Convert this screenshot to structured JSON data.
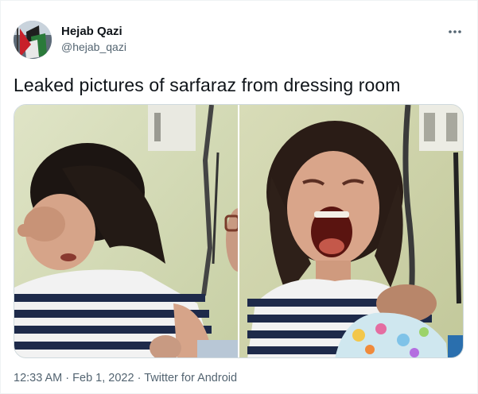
{
  "author": {
    "display_name": "Hejab Qazi",
    "handle": "@hejab_qazi"
  },
  "menu": {
    "more_icon": "more-horizontal-icon"
  },
  "tweet": {
    "text": "Leaked pictures of sarfaraz from dressing room"
  },
  "media": {
    "photo_count": 2
  },
  "meta": {
    "time": "12:33 AM",
    "separator1": " · ",
    "date": "Feb 1, 2022",
    "separator2": " · ",
    "source": "Twitter for Android"
  },
  "colors": {
    "text_primary": "#0f1419",
    "text_secondary": "#536471",
    "border": "#cfd9de"
  }
}
